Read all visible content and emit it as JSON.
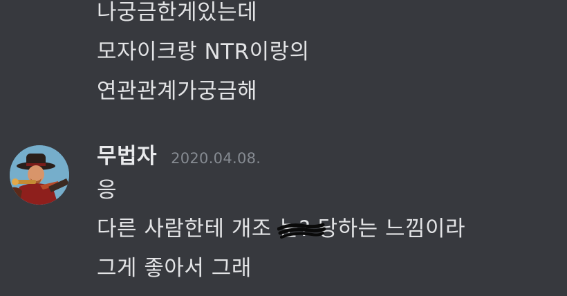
{
  "messages_prev": [
    "나궁금한게있는데",
    "모자이크랑 NTR이랑의",
    "연관관계가궁금해"
  ],
  "author": {
    "username": "무법자",
    "timestamp": "2020.04.08."
  },
  "messages": {
    "line1": "응",
    "line2_before": "다른 사람한테 개조 ",
    "line2_scribbled": "눈?",
    "line2_after": " 당하는 느낌이라",
    "line3": "그게 좋아서 그래"
  },
  "colors": {
    "background": "#37393e",
    "text": "#e3e4e6",
    "timestamp": "#868b92",
    "scribble": "#0a0a0a"
  },
  "icons": {
    "avatar": "cowboy-hat-gunslinger-avatar"
  }
}
